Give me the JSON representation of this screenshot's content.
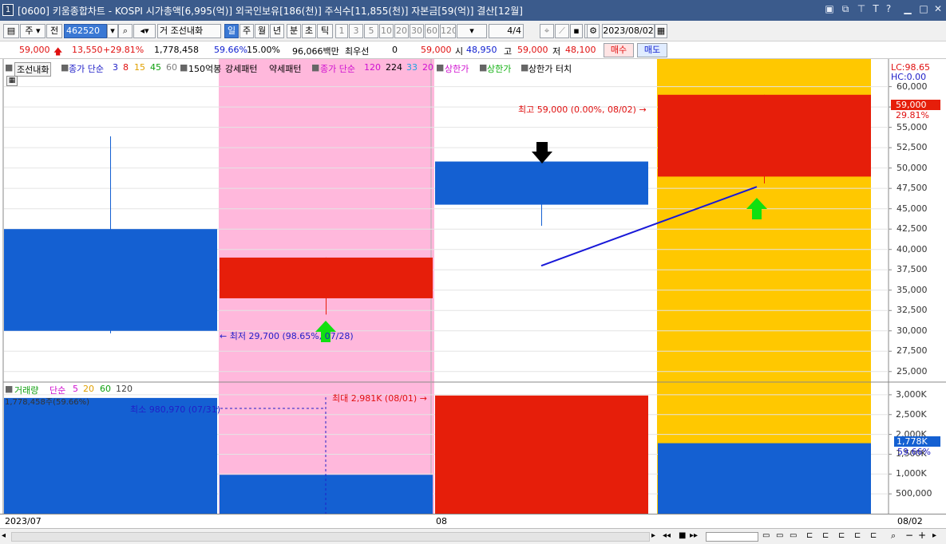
{
  "window": {
    "number": "1",
    "title": "[0600] 키움종합차트 - KOSPI 시가총액[6,995(억)] 외국인보유[186(천)] 주식수[11,855(천)] 자본금[59(억)] 결산[12월]",
    "icons": [
      "window-icon",
      "layout-icon",
      "pin-icon",
      "font-icon",
      "help-icon",
      "minimize-icon",
      "restore-icon",
      "close-icon"
    ]
  },
  "toolbar": {
    "type_select": "주",
    "prev_button": "전",
    "code_value": "462520",
    "name_label": "거",
    "stock_name": "조선내화",
    "periods": [
      "일",
      "주",
      "월",
      "년",
      "분",
      "초",
      "틱"
    ],
    "active_period": "일",
    "intervals": [
      "1",
      "3",
      "5",
      "10",
      "20",
      "30",
      "60",
      "120"
    ],
    "page": "4",
    "page_total": "/4",
    "date": "2023/08/02"
  },
  "quote": {
    "price": "59,000",
    "change": "13,550",
    "change_pct": "+29.81%",
    "volume": "1,778,458",
    "vol_ratio": "59.66%",
    "ratio2": "15.00%",
    "amount": "96,066백만",
    "pref_label": "최우선",
    "pref_value": "0",
    "current": "59,000",
    "open_label": "시",
    "open": "48,950",
    "high_label": "고",
    "high": "59,000",
    "low_label": "저",
    "low": "48,100",
    "buy_button": "매수",
    "sell_button": "매도"
  },
  "legend": {
    "stock_name": "조선내화",
    "ma_label": "종가 단순",
    "ma_periods": [
      "3",
      "8",
      "15",
      "45",
      "60"
    ],
    "ma_colors": [
      "#2020c8",
      "#e01010",
      "#e0a000",
      "#10a010",
      "#808080"
    ],
    "vol_avg": "150억봉",
    "strong": "강세패턴",
    "weak": "약세패턴",
    "ma2_label": "종가 단순",
    "ma2_periods": [
      "120",
      "224",
      "33",
      "20"
    ],
    "ma2_colors": [
      "#d010d0",
      "#000000",
      "#20a0e0",
      "#d010d0"
    ],
    "limit_up": "상한가",
    "limit_up2": "상한가",
    "limit_touch": "상한가 터치"
  },
  "price_panel": {
    "lc": "LC:98.65",
    "hc": "HC:0.00",
    "price_tag": "59,000",
    "pct_tag": "29.81%",
    "high_annotation": "최고 59,000 (0.00%, 08/02)",
    "low_annotation": "최저 29,700 (98.65%, 07/28)",
    "ticks": [
      "60,000",
      "57,500",
      "55,000",
      "52,500",
      "50,000",
      "47,500",
      "45,000",
      "42,500",
      "40,000",
      "37,500",
      "35,000",
      "32,500",
      "30,000",
      "27,500",
      "25,000"
    ],
    "tick_values": [
      60000,
      57500,
      55000,
      52500,
      50000,
      47500,
      45000,
      42500,
      40000,
      37500,
      35000,
      32500,
      30000,
      27500,
      25000
    ]
  },
  "volume_panel": {
    "label": "거래량",
    "ma_label": "단순",
    "ma_periods": [
      "5",
      "20",
      "60",
      "120"
    ],
    "ma_colors": [
      "#d010d0",
      "#e0a000",
      "#10a010",
      "#404040"
    ],
    "current": "1,778,458주(59.66%)",
    "max_annotation": "최대 2,981K (08/01)",
    "min_annotation": "최소 980,970 (07/31)",
    "vol_tag": "1,778K",
    "vol_pct": "59.66%",
    "ticks": [
      "3,000K",
      "2,500K",
      "2,000K",
      "1,500K",
      "1,000K",
      "500,000"
    ],
    "tick_values": [
      3000000,
      2500000,
      2000000,
      1500000,
      1000000,
      500000
    ]
  },
  "x_axis": {
    "left_label": "2023/07",
    "mid_label": "08",
    "right_label": "08/02"
  },
  "chart_data": {
    "type": "candlestick",
    "candles": [
      {
        "date": "07/28",
        "open": 42500,
        "high": 53900,
        "low": 29700,
        "close": 30000,
        "color": "blue",
        "bg": "none"
      },
      {
        "date": "07/31",
        "open": 34000,
        "high": 39000,
        "low": 32000,
        "close": 39000,
        "color": "red",
        "bg": "pink"
      },
      {
        "date": "08/01",
        "open": 50800,
        "high": 50800,
        "low": 42900,
        "close": 45500,
        "color": "blue",
        "bg": "none"
      },
      {
        "date": "08/02",
        "open": 48950,
        "high": 59000,
        "low": 48100,
        "close": 59000,
        "color": "red",
        "bg": "gold"
      }
    ],
    "volume": [
      2920000,
      980970,
      2981000,
      1778458
    ],
    "volume_colors": [
      "blue",
      "blue",
      "red",
      "blue"
    ],
    "ma_line": [
      {
        "date": "08/01",
        "value": 38000
      },
      {
        "date": "08/02",
        "value": 47700
      }
    ],
    "y_range": [
      24000,
      63000
    ],
    "vol_range": [
      0,
      3300000
    ],
    "colors": {
      "up": "#e61e0a",
      "down": "#1460d2",
      "pink": "#ffb8dc",
      "gold": "#ffc800",
      "ma": "#1818d8"
    }
  }
}
